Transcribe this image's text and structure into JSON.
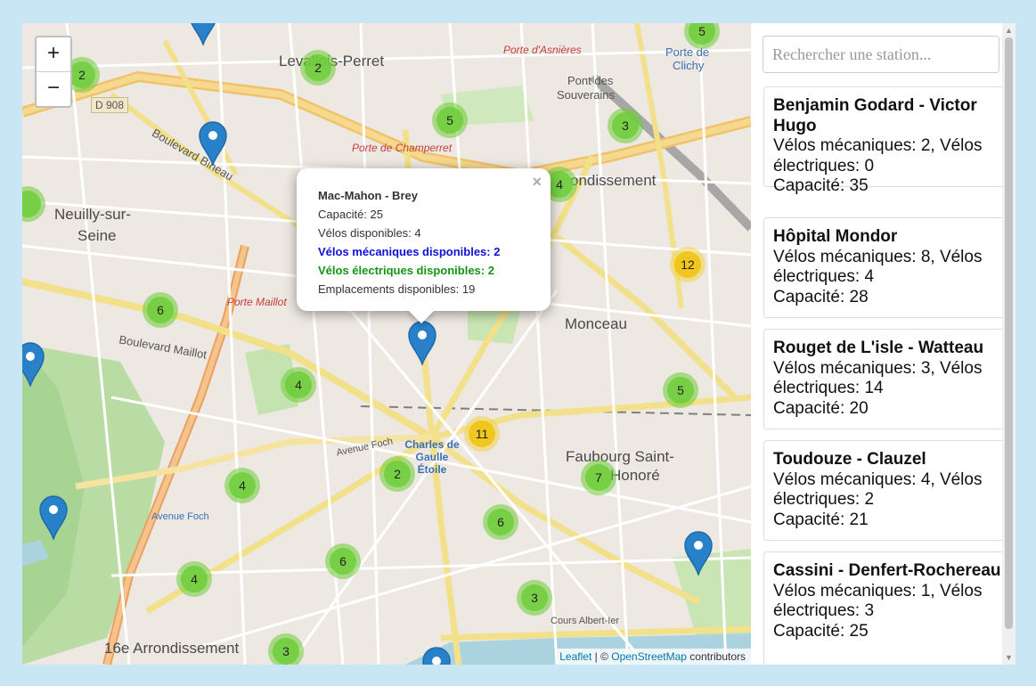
{
  "map": {
    "zoom_in_label": "+",
    "zoom_out_label": "−",
    "attribution": {
      "leaflet": "Leaflet",
      "separator": " | © ",
      "osm": "OpenStreetMap",
      "suffix": " contributors"
    },
    "place_labels": {
      "levallois": "Levallois-Perret",
      "neuilly_1": "Neuilly-sur-",
      "neuilly_2": "Seine",
      "monceau": "Monceau",
      "faubourg_1": "Faubourg Saint-",
      "faubourg_2": "Honoré",
      "arrondissement_16": "16e Arrondissement",
      "arrondissement_17": "ondissement",
      "pont_souverains_1": "Pont des",
      "pont_souverains_2": "Souverains",
      "porte_clichy_1": "Porte de",
      "porte_clichy_2": "Clichy",
      "porte_asnieres": "Porte d'Asnières",
      "porte_champerret": "Porte de Champerret",
      "porte_maillot": "Porte Maillot",
      "bd_bineau": "Boulevard Bineau",
      "bd_maillot": "Boulevard Maillot",
      "avenue_foch": "Avenue Foch",
      "avenue_foch_2": "Avenue Foch",
      "charles_de_gaulle": "Charles de Gaulle Étoile",
      "cours_albert": "Cours Albert-Ier",
      "d908": "D 908"
    },
    "clusters": [
      {
        "count": "2",
        "size": "small"
      },
      {
        "count": "2",
        "size": "small"
      },
      {
        "count": "5",
        "size": "small"
      },
      {
        "count": "5",
        "size": "small"
      },
      {
        "count": "3",
        "size": "small"
      },
      {
        "count": "4",
        "size": "small"
      },
      {
        "count": "12",
        "size": "medium"
      },
      {
        "count": "6",
        "size": "small"
      },
      {
        "count": "4",
        "size": "small"
      },
      {
        "count": "5",
        "size": "small"
      },
      {
        "count": "11",
        "size": "medium"
      },
      {
        "count": "2",
        "size": "small"
      },
      {
        "count": "7",
        "size": "small"
      },
      {
        "count": "4",
        "size": "small"
      },
      {
        "count": "6",
        "size": "small"
      },
      {
        "count": "6",
        "size": "small"
      },
      {
        "count": "4",
        "size": "small"
      },
      {
        "count": "3",
        "size": "small"
      },
      {
        "count": "3",
        "size": "small"
      }
    ],
    "popup": {
      "title": "Mac-Mahon - Brey",
      "capacity": "Capacité: 25",
      "bikes": "Vélos disponibles: 4",
      "mechanical": "Vélos mécaniques disponibles: 2",
      "electric": "Vélos électriques disponibles: 2",
      "docks": "Emplacements disponibles: 19",
      "close_label": "×"
    },
    "colors": {
      "marker": "#2981ca",
      "cluster_small": "#6ecc39",
      "cluster_medium": "#f0c20c",
      "mechanical_text": "#1010d8",
      "electric_text": "#149414"
    }
  },
  "sidebar": {
    "search_placeholder": "Rechercher une station...",
    "stations": [
      {
        "name": "Benjamin Godard - Victor Hugo",
        "bikes": "Vélos mécaniques: 2, Vélos électriques: 0",
        "capacity": "Capacité: 35"
      },
      {
        "name": "Hôpital Mondor",
        "bikes": "Vélos mécaniques: 8, Vélos électriques: 4",
        "capacity": "Capacité: 28"
      },
      {
        "name": "Rouget de L'isle - Watteau",
        "bikes": "Vélos mécaniques: 3, Vélos électriques: 14",
        "capacity": "Capacité: 20"
      },
      {
        "name": "Toudouze - Clauzel",
        "bikes": "Vélos mécaniques: 4, Vélos électriques: 2",
        "capacity": "Capacité: 21"
      },
      {
        "name": "Cassini - Denfert-Rochereau",
        "bikes": "Vélos mécaniques: 1, Vélos électriques: 3",
        "capacity": "Capacité: 25"
      }
    ]
  }
}
